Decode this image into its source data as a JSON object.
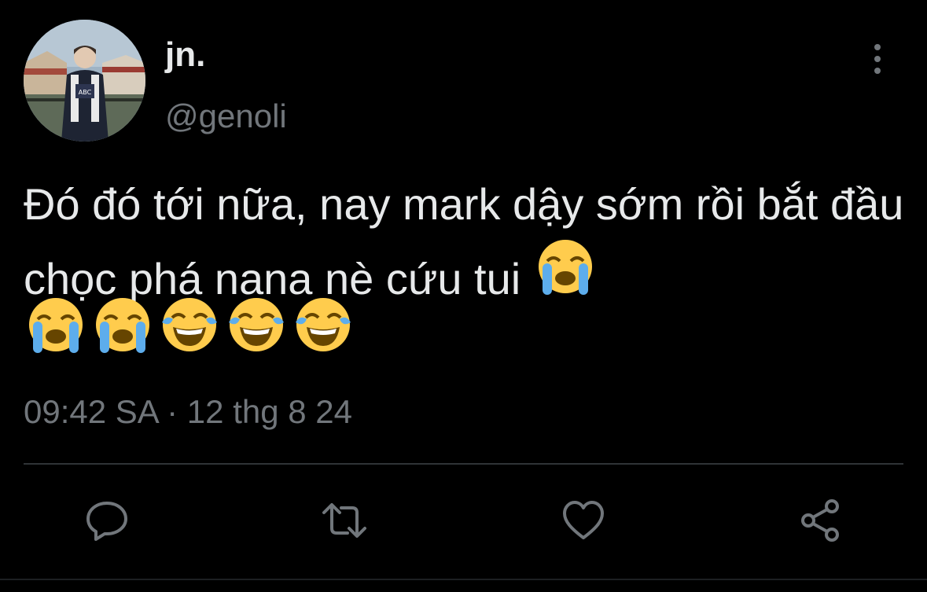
{
  "user": {
    "display_name": "jn.",
    "handle": "@genoli"
  },
  "tweet": {
    "text": "Đó đó tới nữa, nay mark dậy sớm rồi bắt đầu chọc phá nana nè cứu tui",
    "emojis": [
      "loudly-crying-face",
      "loudly-crying-face",
      "loudly-crying-face",
      "face-with-tears-of-joy",
      "face-with-tears-of-joy",
      "face-with-tears-of-joy"
    ],
    "timestamp": "09:42 SA · 12 thg 8 24"
  },
  "actions": {
    "reply_icon": "speech-bubble-icon",
    "retweet_icon": "retweet-icon",
    "like_icon": "heart-icon",
    "share_icon": "share-icon"
  },
  "colors": {
    "background": "#000000",
    "primary_text": "#e7e9ea",
    "secondary_text": "#71767b",
    "divider": "#2f3336"
  }
}
